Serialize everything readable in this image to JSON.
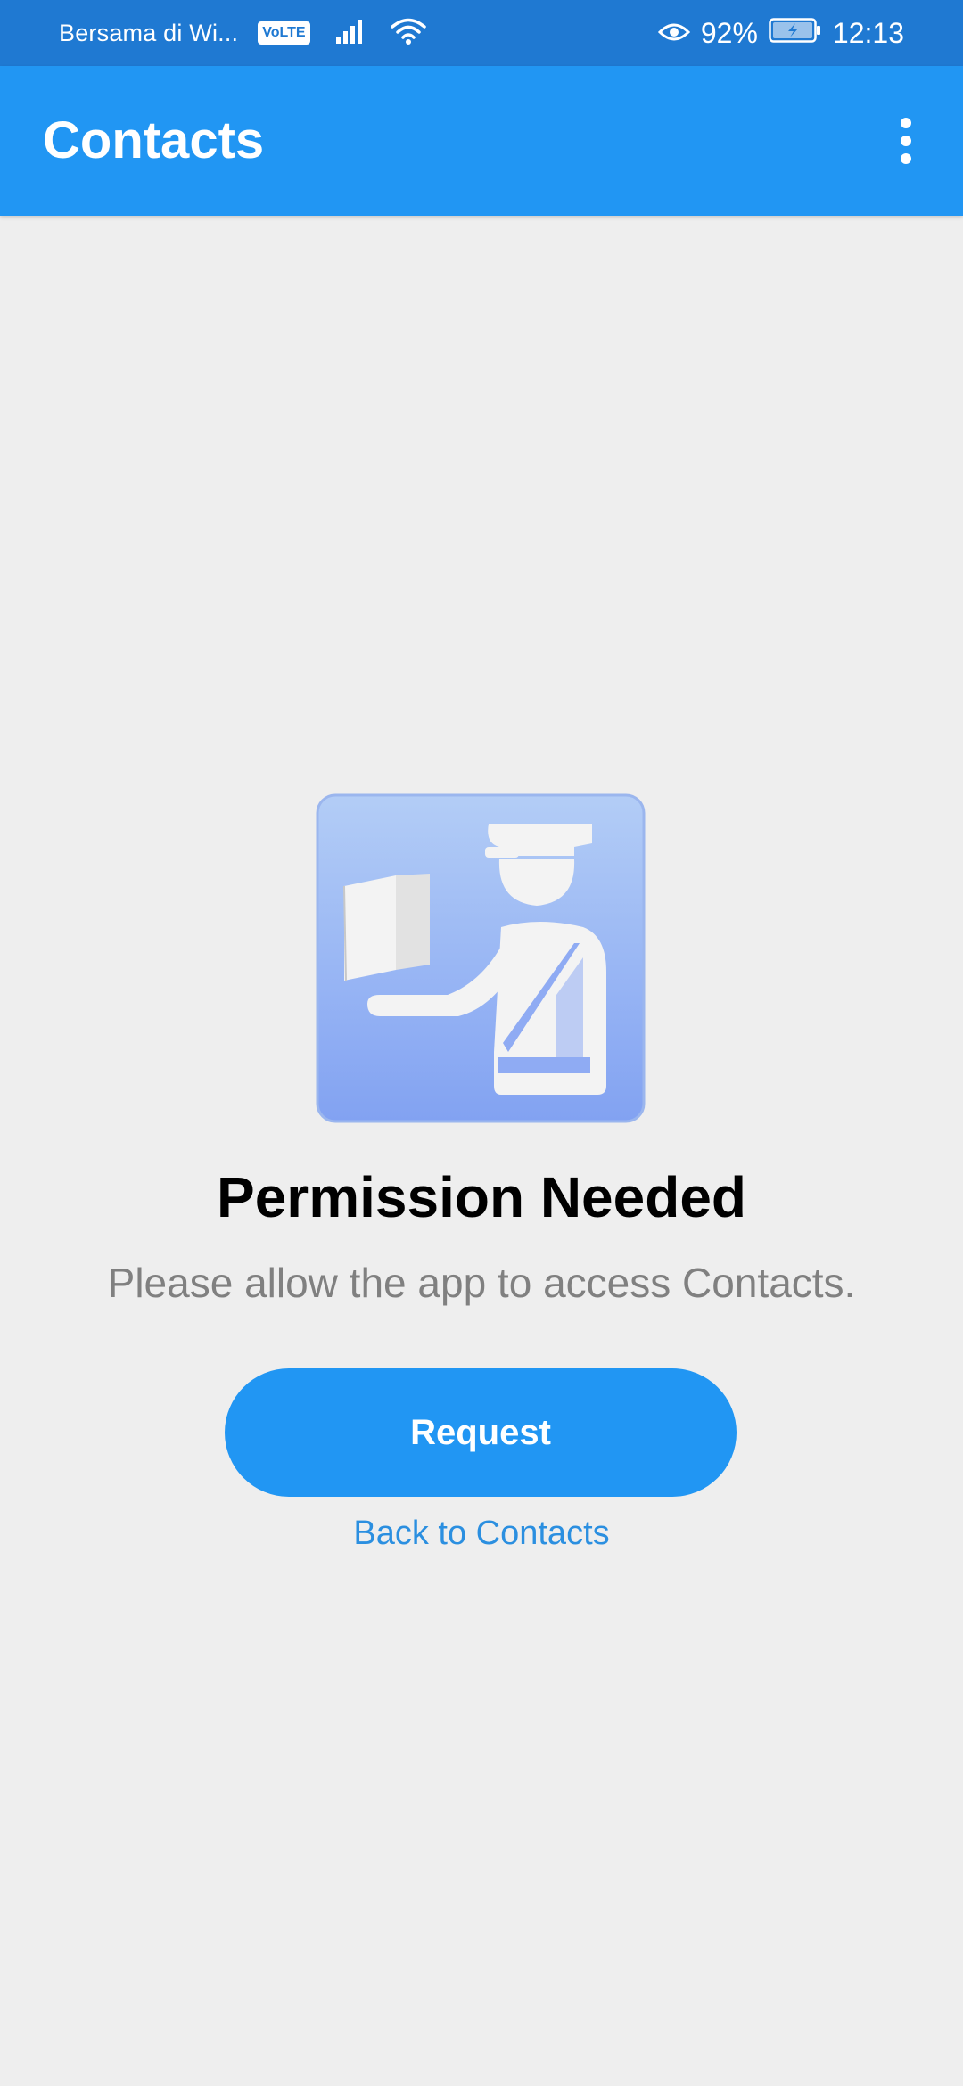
{
  "status_bar": {
    "carrier": "Bersama di Wi...",
    "volte_badge": "VoLTE",
    "battery_percent": "92%",
    "time": "12:13",
    "icons": [
      "volte-icon",
      "signal-icon",
      "wifi-icon",
      "eye-icon",
      "battery-charging-icon"
    ]
  },
  "app_bar": {
    "title": "Contacts",
    "menu_icon": "overflow-menu-icon"
  },
  "permission": {
    "illustration": "customs-officer-icon",
    "title": "Permission Needed",
    "message": "Please allow the app to access Contacts.",
    "request_label": "Request",
    "back_label": "Back to Contacts"
  },
  "colors": {
    "status_bar": "#1f79d2",
    "app_bar": "#2196f3",
    "background": "#eeeeee",
    "accent": "#2196f3"
  }
}
